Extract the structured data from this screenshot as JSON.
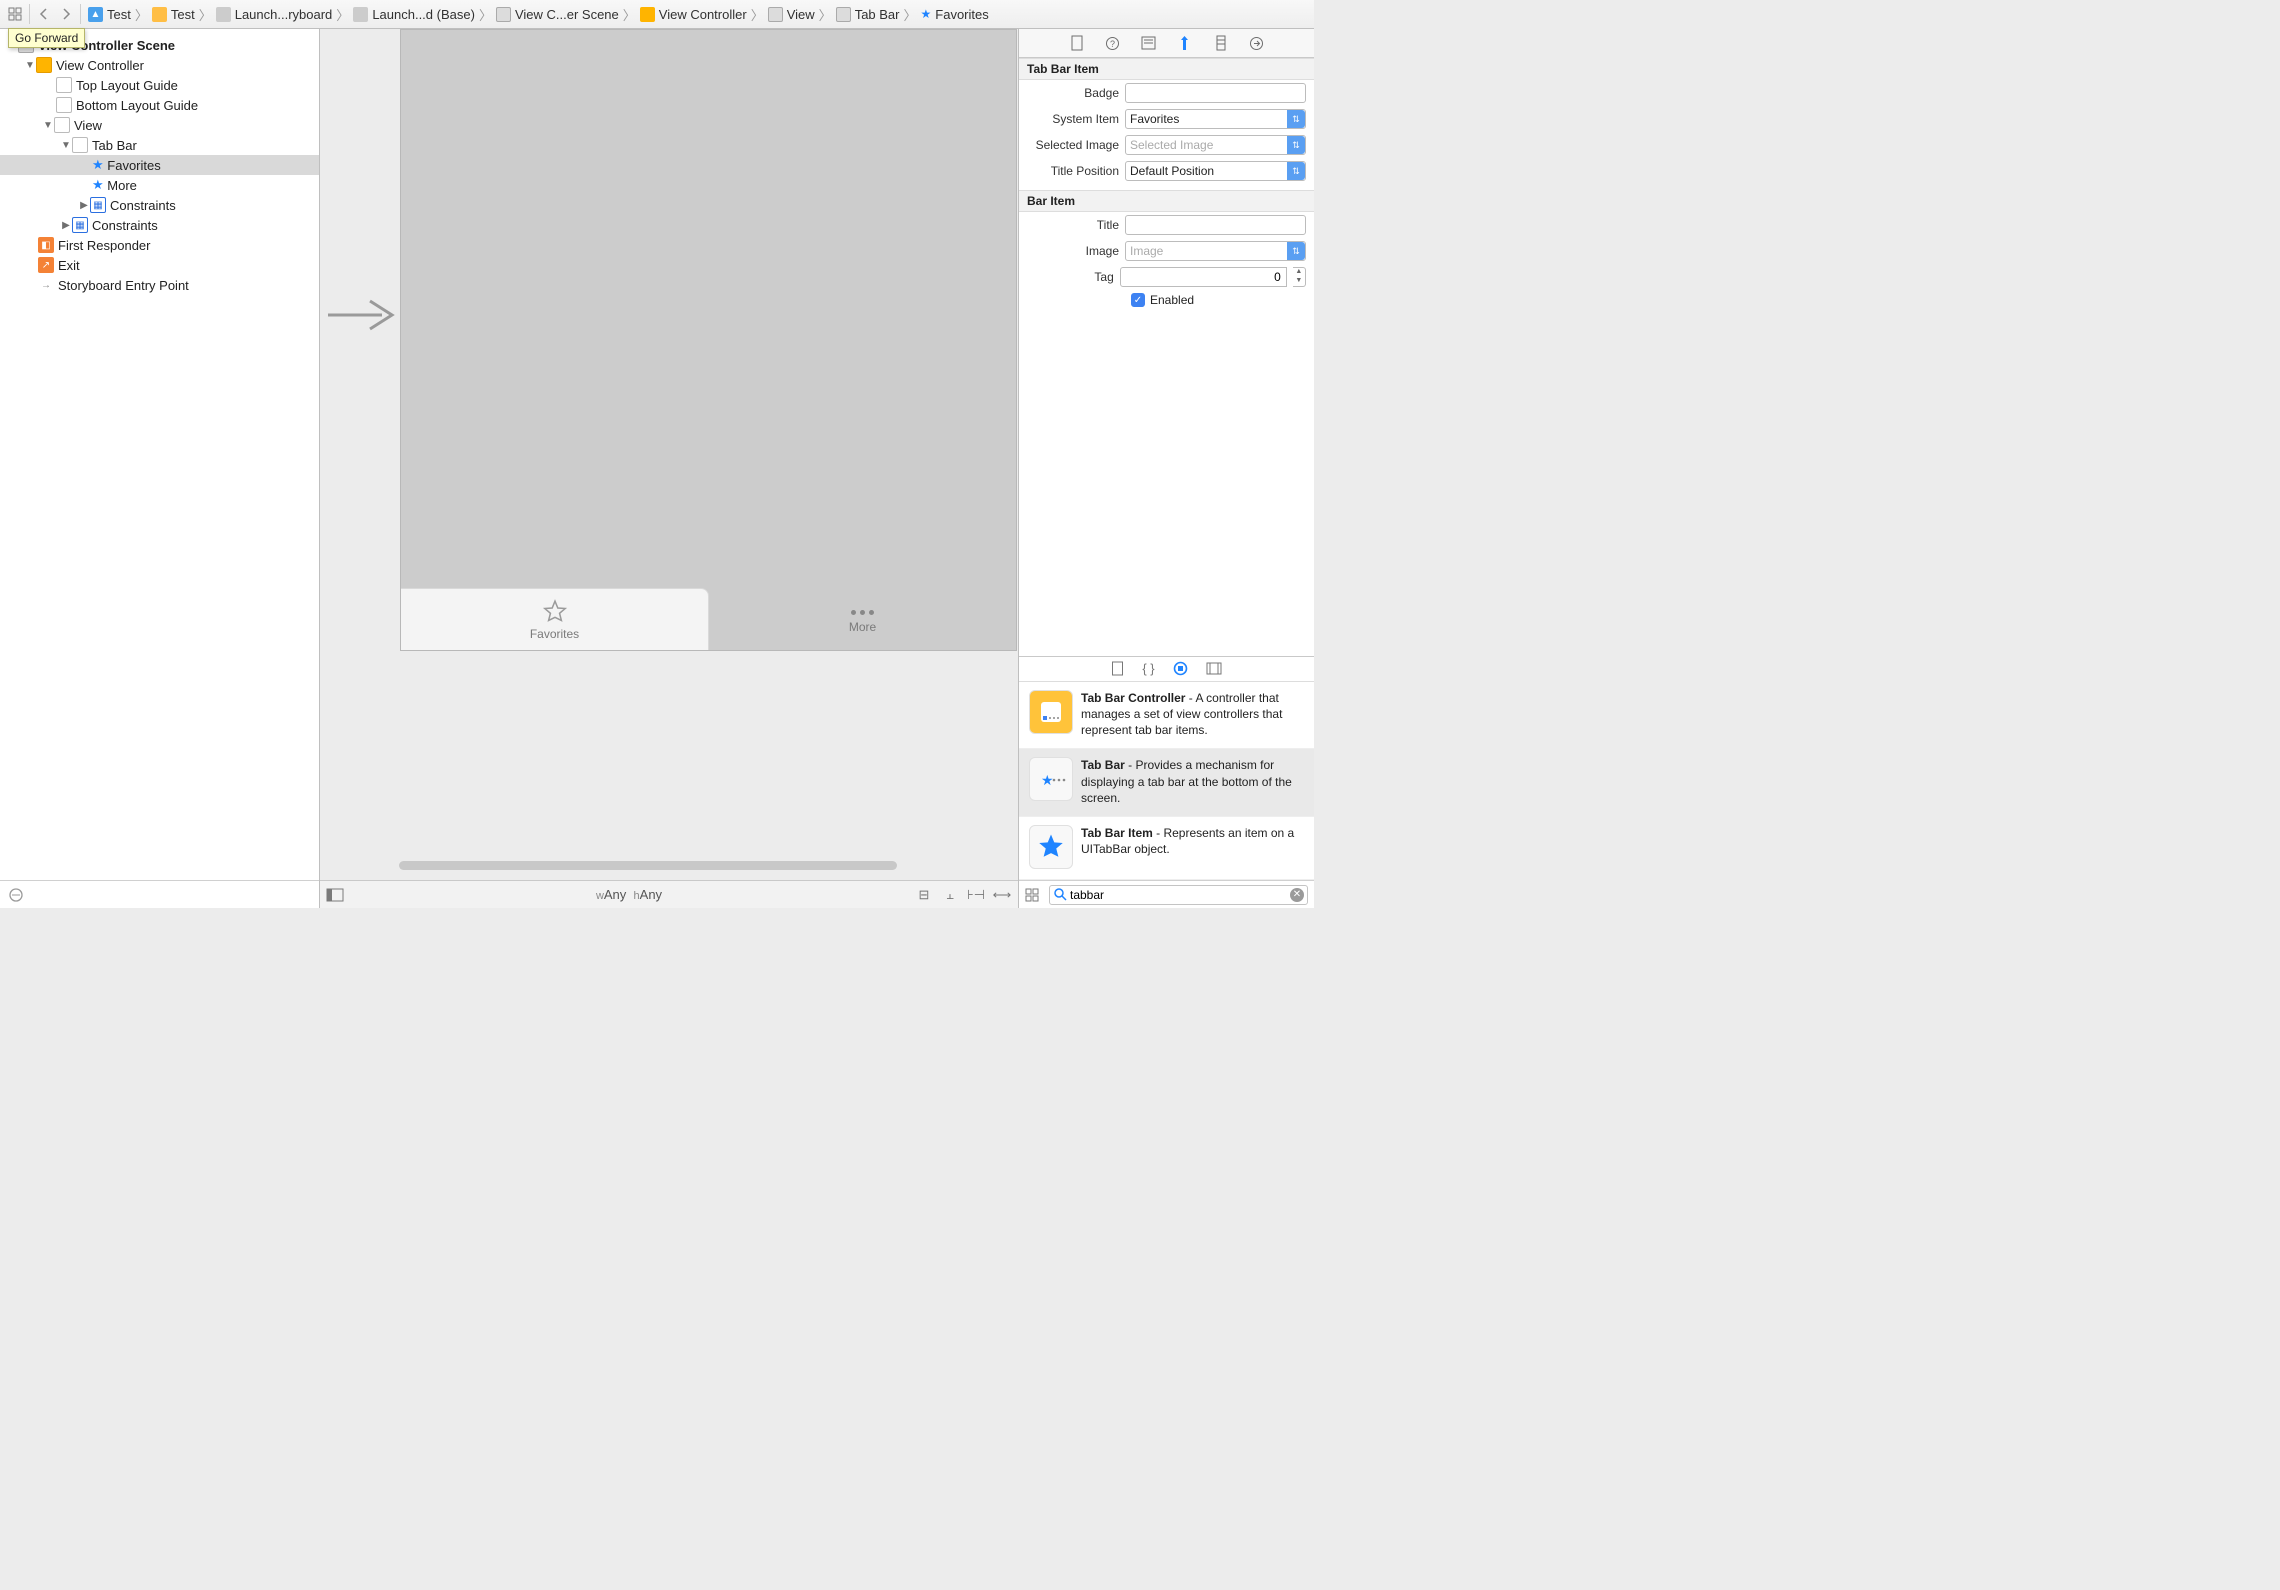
{
  "tooltip": "Go Forward",
  "breadcrumb": [
    {
      "icon": "blue",
      "label": "Test"
    },
    {
      "icon": "folder",
      "label": "Test"
    },
    {
      "icon": "sb",
      "label": "Launch...ryboard"
    },
    {
      "icon": "sb",
      "label": "Launch...d (Base)"
    },
    {
      "icon": "grey",
      "label": "View C...er Scene"
    },
    {
      "icon": "orange",
      "label": "View Controller"
    },
    {
      "icon": "grey",
      "label": "View"
    },
    {
      "icon": "grey",
      "label": "Tab Bar"
    },
    {
      "icon": "star",
      "label": "Favorites"
    }
  ],
  "outline": {
    "scene": "View Controller Scene",
    "vc": "View Controller",
    "top_guide": "Top Layout Guide",
    "bottom_guide": "Bottom Layout Guide",
    "view": "View",
    "tabbar": "Tab Bar",
    "fav": "Favorites",
    "more": "More",
    "constraints": "Constraints",
    "constraints2": "Constraints",
    "first_responder": "First Responder",
    "exit": "Exit",
    "entry": "Storyboard Entry Point"
  },
  "canvas": {
    "tab1": "Favorites",
    "tab2": "More",
    "w": "w",
    "any": "Any",
    "h": "h"
  },
  "inspector": {
    "tabbaritem_hd": "Tab Bar Item",
    "badge_lbl": "Badge",
    "badge_val": "",
    "systemitem_lbl": "System Item",
    "systemitem_val": "Favorites",
    "selimg_lbl": "Selected Image",
    "selimg_ph": "Selected Image",
    "titlepos_lbl": "Title Position",
    "titlepos_val": "Default Position",
    "baritem_hd": "Bar Item",
    "title_lbl": "Title",
    "title_val": "",
    "image_lbl": "Image",
    "image_ph": "Image",
    "tag_lbl": "Tag",
    "tag_val": "0",
    "enabled_lbl": "Enabled"
  },
  "library": {
    "items": [
      {
        "title": "Tab Bar Controller",
        "desc": " - A controller that manages a set of view controllers that represent tab bar items."
      },
      {
        "title": "Tab Bar",
        "desc": " - Provides a mechanism for displaying a tab bar at the bottom of the screen."
      },
      {
        "title": "Tab Bar Item",
        "desc": " - Represents an item on a UITabBar object."
      }
    ],
    "search": "tabbar"
  }
}
